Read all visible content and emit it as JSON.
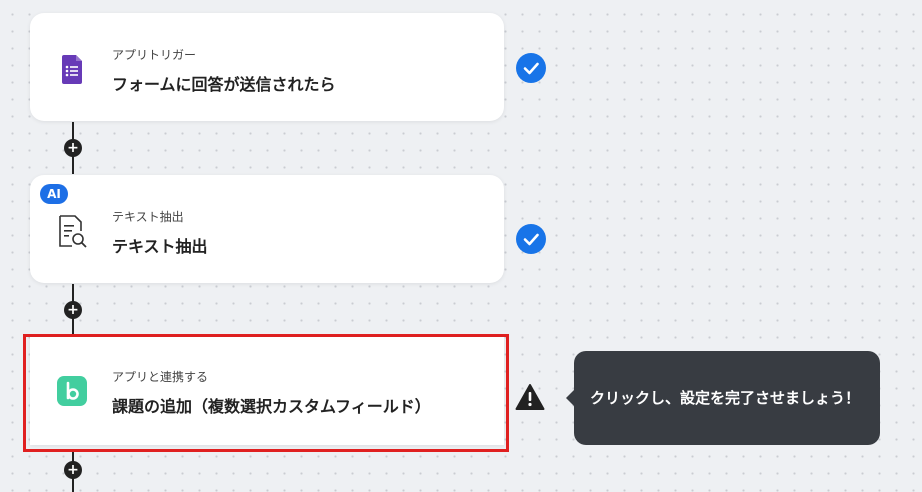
{
  "steps": [
    {
      "subtitle": "アプリトリガー",
      "title": "フォームに回答が送信されたら",
      "icon": "google-forms-icon",
      "status": "completed"
    },
    {
      "subtitle": "テキスト抽出",
      "title": "テキスト抽出",
      "icon": "document-search-icon",
      "badge": "AI",
      "status": "completed"
    },
    {
      "subtitle": "アプリと連携する",
      "title": "課題の追加（複数選択カスタムフィールド）",
      "icon": "backlog-app-icon",
      "status": "warning"
    }
  ],
  "tooltip": {
    "text": "クリックし、設定を完了させましょう！"
  },
  "colors": {
    "accent": "#1874e8",
    "highlight": "#e02020",
    "tooltip_bg": "#383c42",
    "forms_purple": "#673ab7",
    "backlog_green": "#42ce9f"
  }
}
